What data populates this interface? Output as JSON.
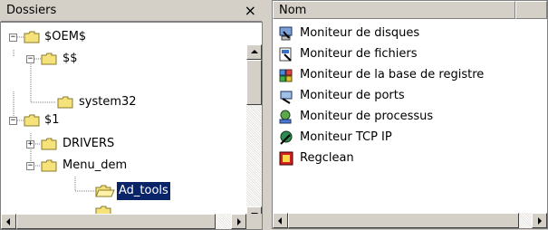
{
  "folders_pane": {
    "title": "Dossiers",
    "close_glyph": "×",
    "tree": [
      {
        "label": "$OEM$",
        "expander": "−"
      },
      {
        "label": "$$",
        "expander": "−"
      },
      {
        "label": "system32",
        "expander": ""
      },
      {
        "label": "$1",
        "expander": "−"
      },
      {
        "label": "DRIVERS",
        "expander": "+"
      },
      {
        "label": "Menu_dem",
        "expander": "−"
      },
      {
        "label": "Ad_tools",
        "expander": "",
        "selected": true
      }
    ]
  },
  "list_pane": {
    "column_header": "Nom",
    "items": [
      {
        "label": "Moniteur de disques",
        "icon": "disk-monitor-icon"
      },
      {
        "label": "Moniteur de fichiers",
        "icon": "file-monitor-icon"
      },
      {
        "label": "Moniteur de la base de registre",
        "icon": "registry-monitor-icon"
      },
      {
        "label": "Moniteur de ports",
        "icon": "port-monitor-icon"
      },
      {
        "label": "Moniteur de processus",
        "icon": "process-monitor-icon"
      },
      {
        "label": "Moniteur TCP IP",
        "icon": "tcpip-monitor-icon"
      },
      {
        "label": "Regclean",
        "icon": "regclean-icon"
      }
    ]
  },
  "colors": {
    "selection": "#0a246a",
    "folder_yellow": "#f6e27a",
    "frame": "#d4d0c8"
  }
}
